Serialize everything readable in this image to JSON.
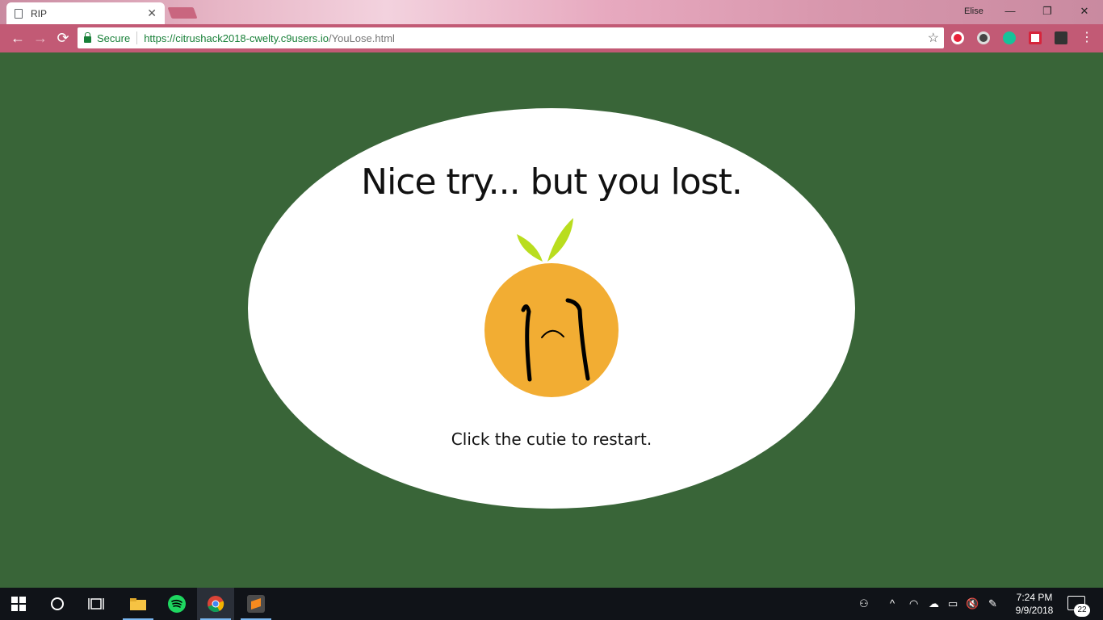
{
  "browser": {
    "tab_title": "RIP",
    "profile_name": "Elise",
    "secure_label": "Secure",
    "url_host": "https://citrushack2018-cwelty.c9users.io",
    "url_path": "/YouLose.html"
  },
  "page": {
    "heading": "Nice try... but you lost.",
    "restart_text": "Click the cutie to restart.",
    "background_color": "#396538",
    "orange_color": "#f2ad33",
    "leaf_color": "#b9dd1e"
  },
  "taskbar": {
    "apps": [
      "start-icon",
      "cortana-icon",
      "task-view-icon",
      "file-explorer-icon",
      "spotify-icon",
      "chrome-icon",
      "sublime-text-icon"
    ],
    "time": "7:24 PM",
    "date": "9/9/2018",
    "notification_count": "22"
  }
}
